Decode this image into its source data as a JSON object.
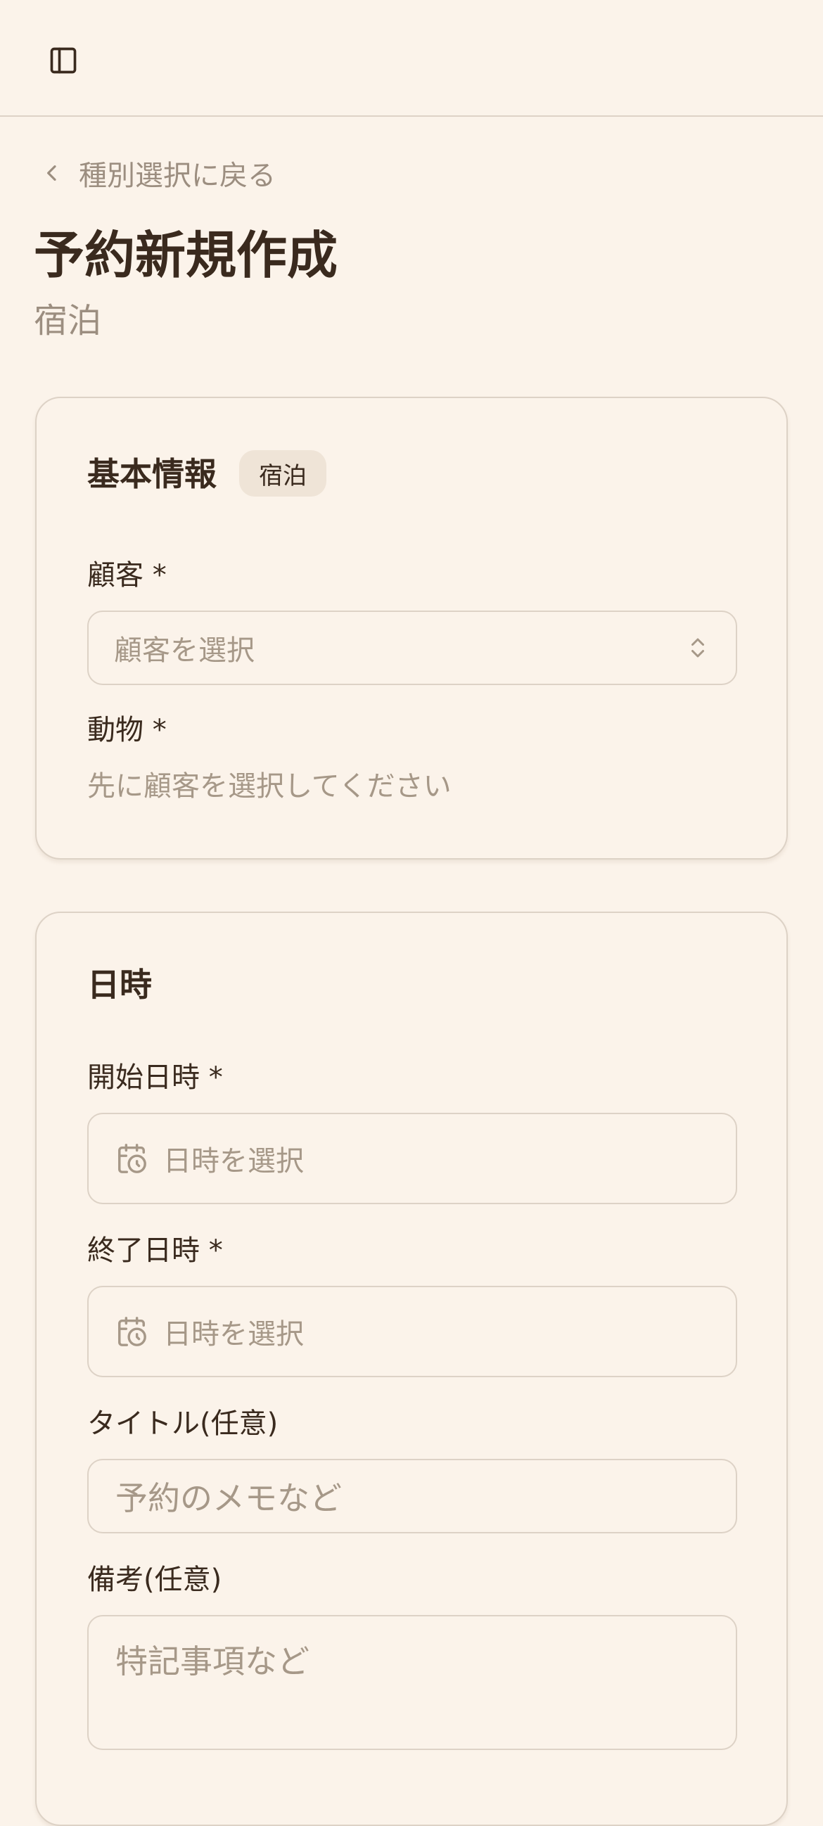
{
  "header": {
    "sidebar_toggle_icon": "sidebar-toggle-icon"
  },
  "nav": {
    "back_label": "種別選択に戻る"
  },
  "page": {
    "title": "予約新規作成",
    "subtitle": "宿泊"
  },
  "basic_info": {
    "title": "基本情報",
    "badge": "宿泊",
    "customer_label": "顧客 *",
    "customer_placeholder": "顧客を選択",
    "animal_label": "動物 *",
    "animal_helper": "先に顧客を選択してください"
  },
  "datetime": {
    "title": "日時",
    "start_label": "開始日時 *",
    "start_placeholder": "日時を選択",
    "end_label": "終了日時 *",
    "end_placeholder": "日時を選択",
    "title_label": "タイトル(任意)",
    "title_placeholder": "予約のメモなど",
    "notes_label": "備考(任意)",
    "notes_placeholder": "特記事項など"
  },
  "colors": {
    "background": "#fbf3ea",
    "text": "#3a2a1e",
    "muted": "#9c8e80",
    "border": "#ddd2c6",
    "badge_bg": "#efe4d7"
  }
}
